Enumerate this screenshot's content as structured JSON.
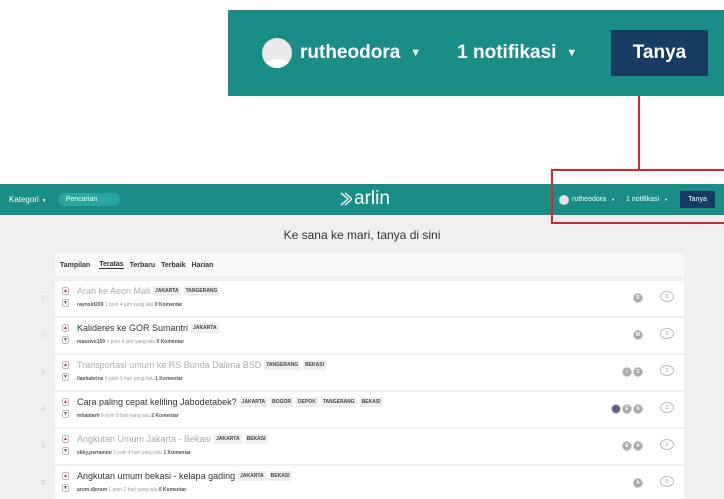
{
  "zoom": {
    "username": "rutheodora",
    "caret": "▼",
    "notifications": "1 notifikasi",
    "ask_label": "Tanya"
  },
  "nav": {
    "category_label": "Kategori",
    "caret": "▼",
    "search_placeholder": "Pencarian",
    "logo_text": "arlin",
    "username": "rutheodora",
    "notifications": "1 notifikasi",
    "ask_label": "Tanya"
  },
  "tagline": "Ke sana ke mari, tanya di sini",
  "tabs": {
    "view_label": "Tampilan",
    "items": [
      "Teratas",
      "Terbaru",
      "Terbaik",
      "Harian"
    ]
  },
  "questions": [
    {
      "num": "1",
      "title": "Arah ke Aeon Mall",
      "tags": [
        "JAKARTA",
        "TANGERANG"
      ],
      "user": "raynold209",
      "info": "1 poin 4 jam yang lalu",
      "comments": "0 Komentar",
      "avatars": [
        "R"
      ],
      "count": "0",
      "faded": true
    },
    {
      "num": "2",
      "title": "Kalideres ke GOR Sumantri",
      "tags": [
        "JAKARTA"
      ],
      "user": "massive169",
      "info": "1 poin 4 jam yang lalu",
      "comments": "0 Komentar",
      "avatars": [
        "M"
      ],
      "count": "0",
      "faded": false
    },
    {
      "num": "3",
      "title": "Transportasi umum ke RS Bunda Dalima BSD",
      "tags": [
        "TANGERANG",
        "BEKASI"
      ],
      "user": "ilashabrina",
      "info": "6 poin 3 hari yang lalu",
      "comments": "1 Komentar",
      "avatars": [
        "I",
        "S"
      ],
      "count": "1",
      "faded": true
    },
    {
      "num": "4",
      "title": "Cara paling cepat keliling Jabodetabek?",
      "tags": [
        "JAKARTA",
        "BOGOR",
        "DEPOK",
        "TANGERANG",
        "BEKASI"
      ],
      "user": "mhaidarh",
      "info": "9 poin 9 hari yang lalu",
      "comments": "2 Komentar",
      "avatars": [
        "",
        "E",
        "A"
      ],
      "count": "2",
      "faded": false
    },
    {
      "num": "5",
      "title": "Angkutan Umum Jakarta - Bekasi",
      "tags": [
        "JAKARTA",
        "BEKASI"
      ],
      "user": "ekky.pertamini",
      "info": "3 poin 4 hari yang lalu",
      "comments": "1 Komentar",
      "avatars": [
        "E",
        "A"
      ],
      "count": "1",
      "faded": true
    },
    {
      "num": "6",
      "title": "Angkutan umum bekasi - kelapa gading",
      "tags": [
        "JAKARTA",
        "BEKASI"
      ],
      "user": "arum.djeram",
      "info": "1 poin 2 hari yang lalu",
      "comments": "0 Komentar",
      "avatars": [
        "A"
      ],
      "count": "0",
      "faded": false
    }
  ],
  "colors": {
    "teal": "#1a8e86",
    "navy": "#173c63",
    "callout": "#e0202a"
  }
}
